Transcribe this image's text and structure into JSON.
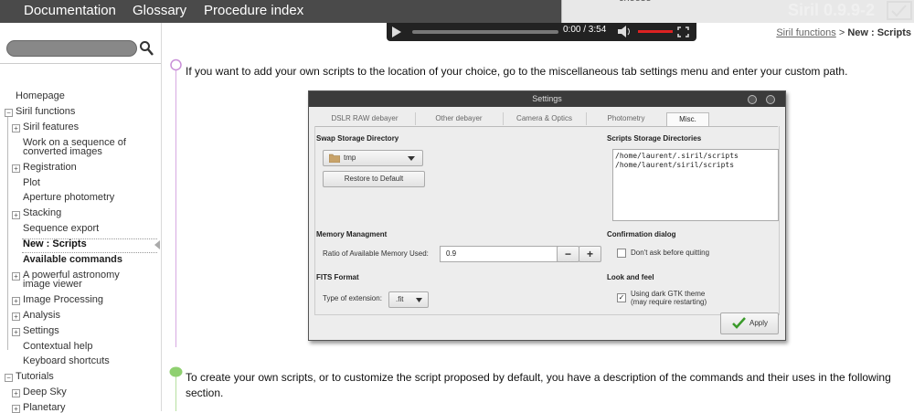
{
  "nav": {
    "items": [
      "Documentation",
      "Glossary",
      "Procedure index"
    ],
    "version": "Siril 0.9.9-2",
    "toolbox_text": "choose"
  },
  "video": {
    "time": "0:00 / 3:54"
  },
  "search": {
    "placeholder": ""
  },
  "breadcrumb": {
    "parent": "Siril functions",
    "separator": ">",
    "current": "New : Scripts"
  },
  "sidebar": {
    "homepage": "Homepage",
    "siril_functions": "Siril functions",
    "siril_features": "Siril features",
    "work_on_sequence": [
      "Work on a sequence of",
      "converted images"
    ],
    "registration": "Registration",
    "plot": "Plot",
    "aperture_photometry": "Aperture photometry",
    "stacking": "Stacking",
    "sequence_export": "Sequence export",
    "new_scripts": "New : Scripts",
    "available_commands": "Available commands",
    "astro_viewer": [
      "A powerful astronomy",
      "image viewer"
    ],
    "image_processing": "Image Processing",
    "analysis": "Analysis",
    "settings": "Settings",
    "contextual_help": "Contextual help",
    "keyboard_shortcuts": "Keyboard shortcuts",
    "tutorials": "Tutorials",
    "deep_sky": "Deep Sky",
    "planetary": "Planetary"
  },
  "content": {
    "para1": "If you want to add your own scripts to the location of your choice, go to the miscellaneous tab settings menu and enter your custom path.",
    "para2_line1": "To create your own scripts, or to customize the script proposed by default, you have a description of the commands and their uses in the following",
    "para2_line2": "section."
  },
  "settings_window": {
    "title": "Settings",
    "tabs": [
      "DSLR RAW debayer",
      "Other debayer",
      "Camera & Optics",
      "Photometry",
      "Misc."
    ],
    "swap_heading": "Swap Storage Directory",
    "swap_value": "tmp",
    "restore_label": "Restore to Default",
    "scripts_heading": "Scripts Storage Directories",
    "scripts_paths": [
      "/home/laurent/.siril/scripts",
      "/home/laurent/siril/scripts"
    ],
    "memory_heading": "Memory Managment",
    "memory_label": "Ratio of Available Memory Used:",
    "memory_value": "0.9",
    "minus": "−",
    "plus": "+",
    "confirm_heading": "Confirmation dialog",
    "confirm_label": "Don't ask before quitting",
    "fits_heading": "FITS Format",
    "fits_label": "Type of extension:",
    "fits_value": ".fit",
    "look_heading": "Look and feel",
    "look_label_1": "Using dark GTK theme",
    "look_label_2": "(may require restarting)",
    "apply_label": "Apply"
  }
}
